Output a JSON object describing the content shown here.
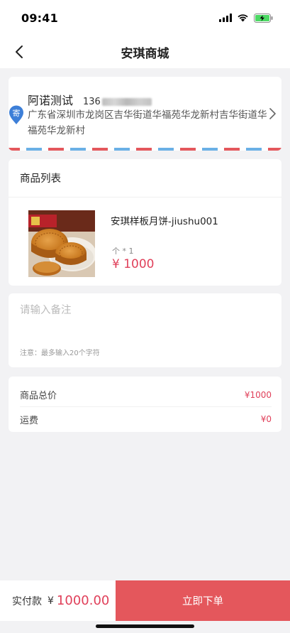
{
  "status_bar": {
    "time": "09:41"
  },
  "nav": {
    "title": "安琪商城"
  },
  "address": {
    "name": "阿诺测试",
    "phone_prefix": "136",
    "pin_label": "寄",
    "full_address": "广东省深圳市龙岗区吉华街道华福苑华龙新村吉华街道华福苑华龙新村"
  },
  "goods": {
    "header": "商品列表",
    "items": [
      {
        "name": "安琪样板月饼-jiushu001",
        "qty": "个 * 1",
        "price": "¥ 1000"
      }
    ]
  },
  "remark": {
    "placeholder": "请输入备注",
    "value": "",
    "note": "注意：最多输入20个字符"
  },
  "summary": {
    "total_label": "商品总价",
    "total_value": "¥1000",
    "shipping_label": "运费",
    "shipping_value": "¥0"
  },
  "bottom": {
    "paid_label": "实付款",
    "currency": "¥",
    "amount": "1000.00",
    "submit_label": "立即下单"
  },
  "colors": {
    "accent": "#e0405a",
    "submit_bg": "#e4575c",
    "pin": "#3d7fd8",
    "airmail_red": "#e4575c",
    "airmail_blue": "#6ab0e6"
  }
}
